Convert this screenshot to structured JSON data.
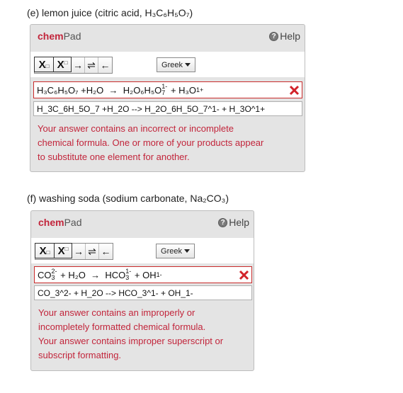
{
  "question_e": {
    "title": "(e) lemon juice (citric acid, H₃C₆H₅O₇)",
    "brand_chem": "chem",
    "brand_pad": "Pad",
    "help_label": "Help",
    "toolbar": {
      "subscript_label": "X□",
      "superscript_label": "X□",
      "arrow_right": "→",
      "arrow_equilibrium": "⇌",
      "arrow_left": "←",
      "greek_label": "Greek"
    },
    "rendered_equation": {
      "reactant_1": "H₃C₆H₅O₇",
      "reactant_2": "+H₂O",
      "arrow": "→",
      "product_1": "H₂O₆H₅O",
      "product_1_sub": "7",
      "product_1_charge": "1-",
      "product_2": "+ H₃O",
      "product_2_charge": "1+"
    },
    "raw_input_value": "H_3C_6H_5O_7 +H_2O --> H_2O_6H_5O_7^1- + H_3O^1+",
    "feedback": [
      "Your answer contains an incorrect or incomplete",
      "chemical formula. One or more of your products appear",
      "to substitute one element for another."
    ]
  },
  "question_f": {
    "title": "(f) washing soda (sodium carbonate, Na₂CO₃)",
    "brand_chem": "chem",
    "brand_pad": "Pad",
    "help_label": "Help",
    "toolbar": {
      "subscript_label": "X□",
      "superscript_label": "X□",
      "arrow_right": "→",
      "arrow_equilibrium": "⇌",
      "arrow_left": "←",
      "greek_label": "Greek"
    },
    "rendered_equation": {
      "reactant_1": "CO",
      "reactant_1_sub": "3",
      "reactant_1_charge": "2-",
      "reactant_2": "+ H₂O",
      "arrow": "→",
      "product_1": "HCO",
      "product_1_sub": "3",
      "product_1_charge": "1-",
      "product_2": "+ OH",
      "product_2_charge": "1-"
    },
    "raw_input_value": "CO_3^2- + H_2O --> HCO_3^1- + OH_1-",
    "feedback": [
      "Your answer contains an improperly or",
      "incompletely formatted chemical formula.",
      "Your answer contains improper superscript or",
      "subscript formatting."
    ]
  },
  "colors": {
    "brand_red": "#c2253b",
    "error_border": "#c92b2b",
    "panel_bg": "#e4e4e4"
  }
}
